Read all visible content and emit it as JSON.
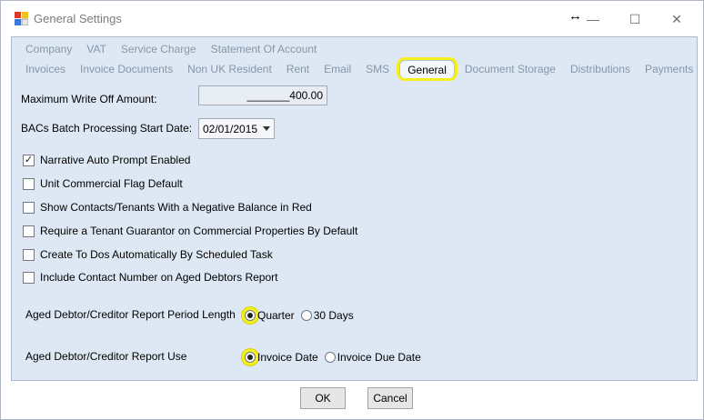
{
  "window": {
    "title": "General Settings",
    "resize_glyph": "↔",
    "minimize_glyph": "—",
    "maximize_glyph": "☐",
    "close_glyph": "✕"
  },
  "tabs": {
    "row1": [
      "Company",
      "VAT",
      "Service Charge",
      "Statement Of Account"
    ],
    "row2": [
      "Invoices",
      "Invoice Documents",
      "Non UK Resident",
      "Rent",
      "Email",
      "SMS",
      "General",
      "Document Storage",
      "Distributions",
      "Payments"
    ],
    "active": "General"
  },
  "fields": {
    "max_write_off_label": "Maximum Write Off Amount:",
    "max_write_off_value": "_______400.00",
    "bacs_label": "BACs Batch Processing Start Date:",
    "bacs_value": "02/01/2015"
  },
  "checkboxes": [
    {
      "label": "Narrative Auto Prompt Enabled",
      "checked": true
    },
    {
      "label": "Unit Commercial Flag Default",
      "checked": false
    },
    {
      "label": "Show Contacts/Tenants With a Negative Balance in Red",
      "checked": false
    },
    {
      "label": "Require a Tenant Guarantor on Commercial Properties By Default",
      "checked": false
    },
    {
      "label": "Create To Dos Automatically By Scheduled Task",
      "checked": false
    },
    {
      "label": "Include Contact Number on Aged Debtors Report",
      "checked": false
    }
  ],
  "period_length": {
    "label": "Aged Debtor/Creditor Report Period Length",
    "options": [
      "Quarter",
      "30 Days"
    ],
    "selected": "Quarter"
  },
  "report_use": {
    "label": "Aged Debtor/Creditor Report Use",
    "options": [
      "Invoice Date",
      "Invoice Due Date"
    ],
    "selected": "Invoice Date"
  },
  "buttons": {
    "ok": "OK",
    "cancel": "Cancel"
  },
  "colors": {
    "panel_bg": "#dde8f4",
    "highlight": "#f4ef1e",
    "inactive_tab": "#8696a8"
  }
}
